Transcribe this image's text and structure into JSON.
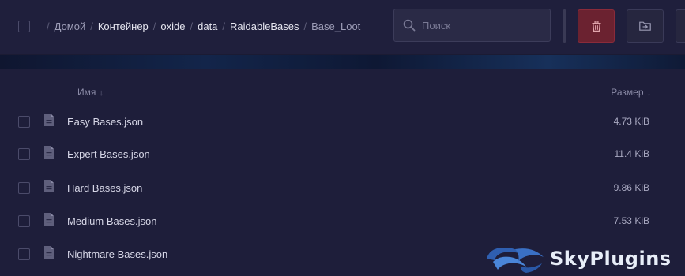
{
  "breadcrumb": [
    {
      "label": "Домой",
      "current": false,
      "dim": true
    },
    {
      "label": "Контейнер",
      "current": false,
      "dim": false
    },
    {
      "label": "oxide",
      "current": false,
      "dim": false
    },
    {
      "label": "data",
      "current": false,
      "dim": false
    },
    {
      "label": "RaidableBases",
      "current": false,
      "dim": false
    },
    {
      "label": "Base_Loot",
      "current": true,
      "dim": true
    }
  ],
  "breadcrumb_separator": "/",
  "search": {
    "placeholder": "Поиск",
    "value": ""
  },
  "toolbar": {
    "delete_icon": "trash-icon",
    "move_icon": "folder-move-icon",
    "delete_color": "#6b2230"
  },
  "list_header": {
    "name_label": "Имя",
    "size_label": "Размер",
    "sort_arrow": "↓"
  },
  "files": [
    {
      "name": "Easy Bases.json",
      "size": "4.73 KiB",
      "icon": "file-icon"
    },
    {
      "name": "Expert Bases.json",
      "size": "11.4 KiB",
      "icon": "file-icon"
    },
    {
      "name": "Hard Bases.json",
      "size": "9.86 KiB",
      "icon": "file-icon"
    },
    {
      "name": "Medium Bases.json",
      "size": "7.53 KiB",
      "icon": "file-icon"
    },
    {
      "name": "Nightmare Bases.json",
      "size": "",
      "icon": "file-icon"
    }
  ],
  "watermark": {
    "text": "SkyPlugins"
  }
}
